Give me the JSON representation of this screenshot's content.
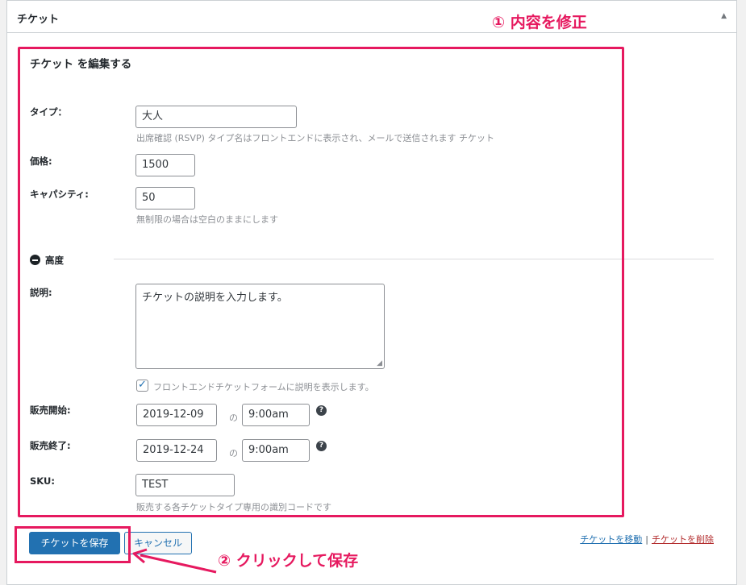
{
  "metabox": {
    "title": "チケット"
  },
  "editor": {
    "title": "チケット を編集する"
  },
  "type_field": {
    "label": "タイプ：",
    "value": "大人",
    "help": "出席確認 (RSVP) タイプ名はフロントエンドに表示され、メールで送信されます チケット"
  },
  "price_field": {
    "label": "価格:",
    "value": "1500"
  },
  "capacity_field": {
    "label": "キャパシティ:",
    "value": "50",
    "help": "無制限の場合は空白のままにします"
  },
  "advanced": {
    "label": "高度"
  },
  "description_field": {
    "label": "説明:",
    "value": "チケットの説明を入力します。",
    "checkbox_label": "フロントエンドチケットフォームに説明を表示します。",
    "checkbox_checked": true
  },
  "sale_start": {
    "label": "販売開始:",
    "date": "2019-12-09",
    "at": "の",
    "time": "9:00am"
  },
  "sale_end": {
    "label": "販売終了:",
    "date": "2019-12-24",
    "at": "の",
    "time": "9:00am"
  },
  "sku_field": {
    "label": "SKU:",
    "value": "TEST",
    "help": "販売する各チケットタイプ専用の識別コードです"
  },
  "actions": {
    "save_label": "チケットを保存",
    "cancel_label": "キャンセル",
    "move_label": "チケットを移動",
    "separator": "|",
    "delete_label": "チケットを削除"
  },
  "annotations": {
    "step1": "① 内容を修正",
    "step2": "② クリックして保存"
  },
  "colors": {
    "highlight": "#e6195f",
    "primary_button": "#2271b1",
    "delete_link": "#b32d2e"
  }
}
